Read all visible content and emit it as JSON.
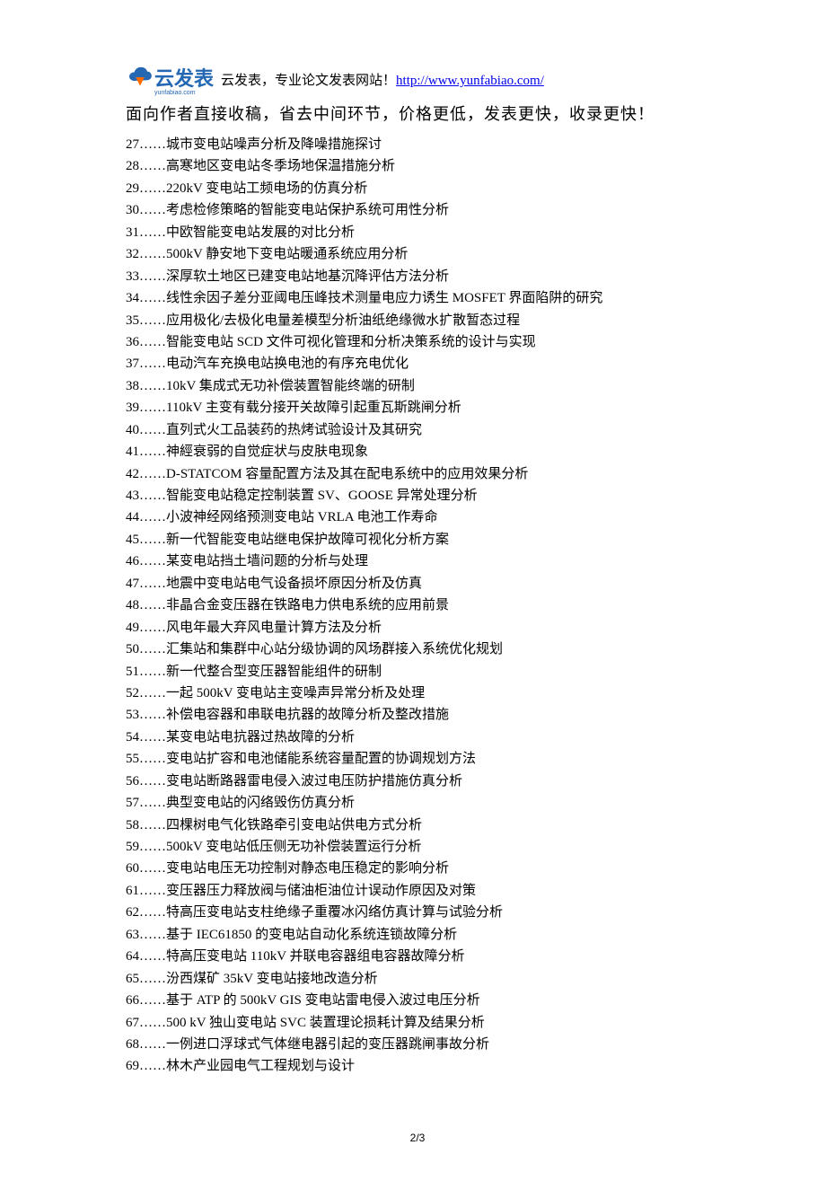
{
  "header": {
    "logo_text": "云发表",
    "logo_sub": "yunfabiao.com",
    "tagline_prefix": "云发表，专业论文发表网站！",
    "link_text": "http://www.yunfabiao.com/",
    "subtitle": "面向作者直接收稿，省去中间环节，价格更低，发表更快，收录更快！"
  },
  "items": [
    {
      "n": "27",
      "t": "城市变电站噪声分析及降噪措施探讨"
    },
    {
      "n": "28",
      "t": "高寒地区变电站冬季场地保温措施分析"
    },
    {
      "n": "29",
      "t": "220kV 变电站工频电场的仿真分析"
    },
    {
      "n": "30",
      "t": "考虑检修策略的智能变电站保护系统可用性分析"
    },
    {
      "n": "31",
      "t": "中欧智能变电站发展的对比分析"
    },
    {
      "n": "32",
      "t": "500kV 静安地下变电站暖通系统应用分析"
    },
    {
      "n": "33",
      "t": "深厚软土地区已建变电站地基沉降评估方法分析"
    },
    {
      "n": "34",
      "t": "线性余因子差分亚阈电压峰技术测量电应力诱生 MOSFET 界面陷阱的研究"
    },
    {
      "n": "35",
      "t": "应用极化/去极化电量差模型分析油纸绝缘微水扩散暂态过程"
    },
    {
      "n": "36",
      "t": "智能变电站 SCD 文件可视化管理和分析决策系统的设计与实现"
    },
    {
      "n": "37",
      "t": "电动汽车充换电站换电池的有序充电优化"
    },
    {
      "n": "38",
      "t": "10kV 集成式无功补偿装置智能终端的研制"
    },
    {
      "n": "39",
      "t": "110kV 主变有载分接开关故障引起重瓦斯跳闸分析"
    },
    {
      "n": "40",
      "t": "直列式火工品装药的热烤试验设计及其研究"
    },
    {
      "n": "41",
      "t": "神經衰弱的自觉症状与皮肤电现象"
    },
    {
      "n": "42",
      "t": "D-STATCOM 容量配置方法及其在配电系统中的应用效果分析"
    },
    {
      "n": "43",
      "t": "智能变电站稳定控制装置 SV、GOOSE 异常处理分析"
    },
    {
      "n": "44",
      "t": "小波神经网络预测变电站 VRLA 电池工作寿命"
    },
    {
      "n": "45",
      "t": "新一代智能变电站继电保护故障可视化分析方案"
    },
    {
      "n": "46",
      "t": "某变电站挡土墙问题的分析与处理"
    },
    {
      "n": "47",
      "t": "地震中变电站电气设备损坏原因分析及仿真"
    },
    {
      "n": "48",
      "t": "非晶合金变压器在铁路电力供电系统的应用前景"
    },
    {
      "n": "49",
      "t": "风电年最大弃风电量计算方法及分析"
    },
    {
      "n": "50",
      "t": "汇集站和集群中心站分级协调的风场群接入系统优化规划"
    },
    {
      "n": "51",
      "t": "新一代整合型变压器智能组件的研制"
    },
    {
      "n": "52",
      "t": "一起 500kV 变电站主变噪声异常分析及处理"
    },
    {
      "n": "53",
      "t": "补偿电容器和串联电抗器的故障分析及整改措施"
    },
    {
      "n": "54",
      "t": "某变电站电抗器过热故障的分析"
    },
    {
      "n": "55",
      "t": "变电站扩容和电池储能系统容量配置的协调规划方法"
    },
    {
      "n": "56",
      "t": "变电站断路器雷电侵入波过电压防护措施仿真分析"
    },
    {
      "n": "57",
      "t": "典型变电站的闪络毁伤仿真分析"
    },
    {
      "n": "58",
      "t": "四棵树电气化铁路牵引变电站供电方式分析"
    },
    {
      "n": "59",
      "t": "500kV 变电站低压侧无功补偿装置运行分析"
    },
    {
      "n": "60",
      "t": "变电站电压无功控制对静态电压稳定的影响分析"
    },
    {
      "n": "61",
      "t": "变压器压力释放阀与储油柜油位计误动作原因及对策"
    },
    {
      "n": "62",
      "t": "特高压变电站支柱绝缘子重覆冰闪络仿真计算与试验分析"
    },
    {
      "n": "63",
      "t": "基于 IEC61850 的变电站自动化系统连锁故障分析"
    },
    {
      "n": "64",
      "t": "特高压变电站 110kV 并联电容器组电容器故障分析"
    },
    {
      "n": "65",
      "t": "汾西煤矿 35kV 变电站接地改造分析"
    },
    {
      "n": "66",
      "t": "基于 ATP 的 500kV GIS 变电站雷电侵入波过电压分析"
    },
    {
      "n": "67",
      "t": "500 kV 独山变电站 SVC 装置理论损耗计算及结果分析"
    },
    {
      "n": "68",
      "t": "一例进口浮球式气体继电器引起的变压器跳闸事故分析"
    },
    {
      "n": "69",
      "t": "林木产业园电气工程规划与设计"
    }
  ],
  "dots": "……",
  "page_num": "2/3"
}
